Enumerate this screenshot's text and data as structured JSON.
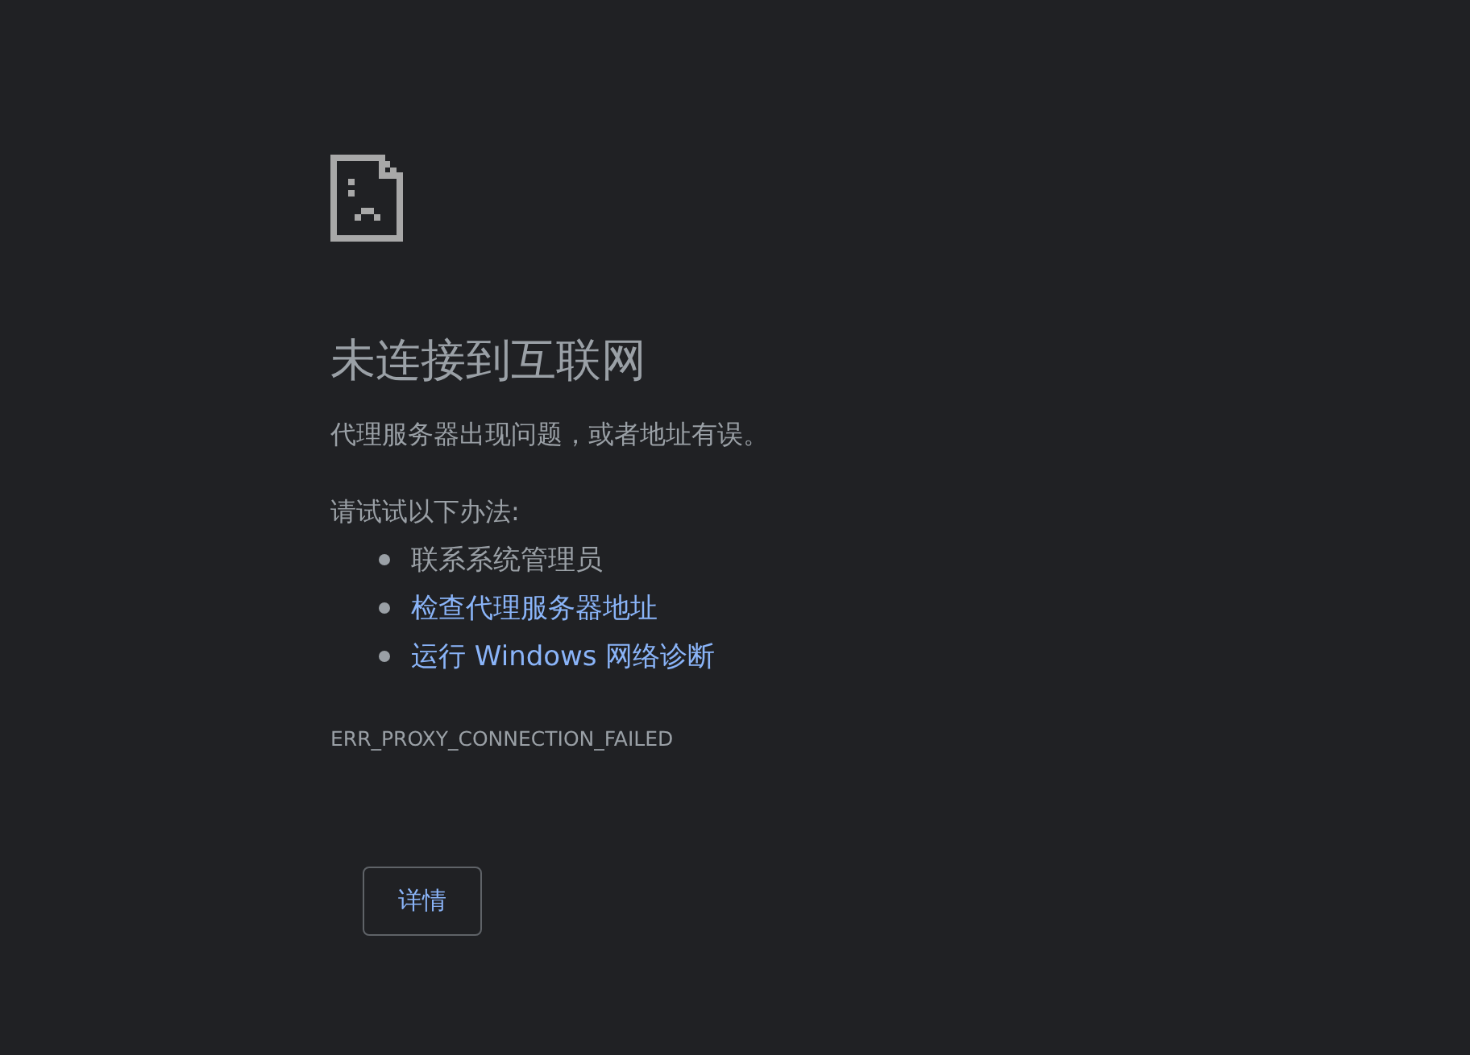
{
  "title": "未连接到互联网",
  "message": "代理服务器出现问题，或者地址有误。",
  "suggestions_heading": "请试试以下办法:",
  "suggestions": [
    {
      "kind": "text",
      "label": "联系系统管理员"
    },
    {
      "kind": "link",
      "label": "检查代理服务器地址"
    },
    {
      "kind": "link",
      "label": "运行 Windows 网络诊断"
    }
  ],
  "error_code": "ERR_PROXY_CONNECTION_FAILED",
  "details_button": "详情"
}
